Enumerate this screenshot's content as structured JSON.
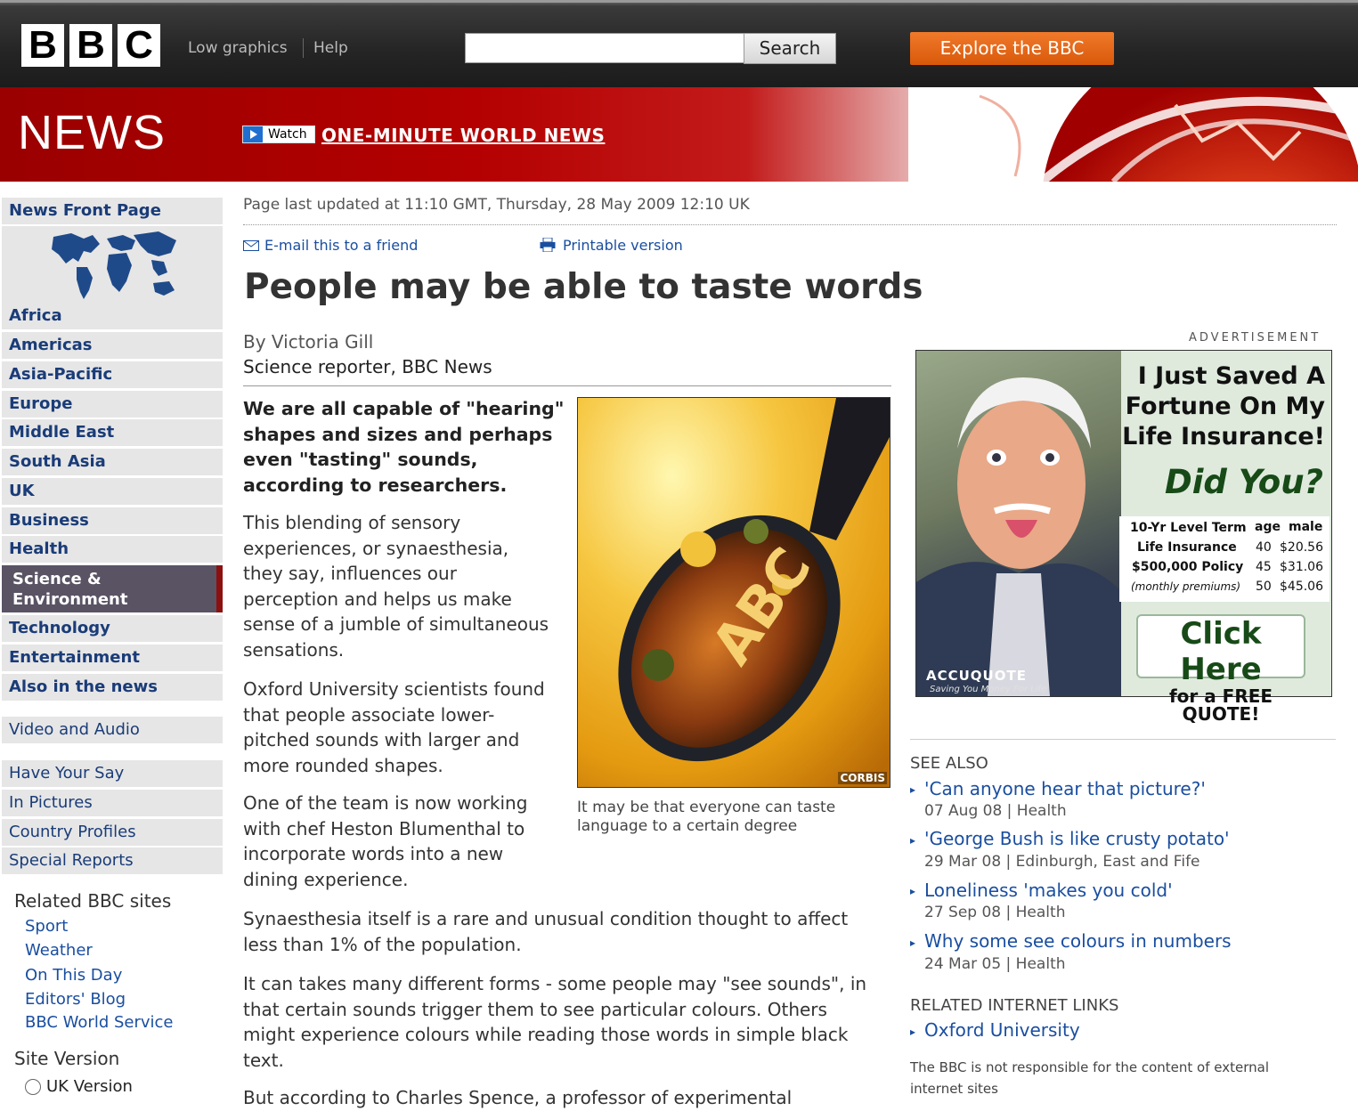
{
  "header": {
    "logo": [
      "B",
      "B",
      "C"
    ],
    "low_graphics": "Low graphics",
    "help": "Help",
    "search_button": "Search",
    "search_value": "",
    "explore": "Explore the BBC"
  },
  "banner": {
    "title": "NEWS",
    "watch_label": "Watch",
    "watch_link": "ONE-MINUTE WORLD NEWS"
  },
  "nav": {
    "front_page": "News Front Page",
    "items": [
      "Africa",
      "Americas",
      "Asia-Pacific",
      "Europe",
      "Middle East",
      "South Asia",
      "UK",
      "Business",
      "Health"
    ],
    "selected_line1": "Science &",
    "selected_line2": "Environment",
    "items2": [
      "Technology",
      "Entertainment",
      "Also in the news"
    ],
    "video_audio": "Video and Audio",
    "items3": [
      "Have Your Say",
      "In Pictures",
      "Country Profiles",
      "Special Reports"
    ],
    "related_heading": "Related BBC sites",
    "related": [
      "Sport",
      "Weather",
      "On This Day",
      "Editors' Blog",
      "BBC World Service"
    ],
    "site_version_heading": "Site Version",
    "uk_version": "UK Version"
  },
  "article": {
    "updated": "Page last updated at 11:10 GMT, Thursday, 28 May 2009 12:10 UK",
    "email": "E-mail this to a friend",
    "print": "Printable version",
    "headline": "People may be able to taste words",
    "author": "By Victoria Gill",
    "role": "Science reporter, BBC News",
    "intro": [
      "We are all capable of \"hearing\"",
      "shapes and sizes and perhaps",
      "even \"tasting\" sounds,",
      "according to researchers."
    ],
    "p1": [
      "This blending of sensory",
      "experiences, or synaesthesia,",
      "they say, influences our",
      "perception and helps us make",
      "sense of a jumble of simultaneous",
      "sensations."
    ],
    "p2": [
      "Oxford University scientists found",
      "that people associate lower-",
      "pitched sounds with larger and",
      "more rounded shapes."
    ],
    "p3": [
      "One of the team is now working",
      "with chef Heston Blumenthal to",
      "incorporate words into a new",
      "dining experience."
    ],
    "p4": [
      "Synaesthesia itself is a rare and unusual condition thought to affect",
      "less than 1% of the population."
    ],
    "p5": [
      "It can takes many different forms - some people may \"see sounds\", in",
      "that certain sounds trigger them to see particular colours. Others",
      "might experience colours while reading those words in simple black",
      "text."
    ],
    "p6": "But according to Charles Spence, a professor of experimental",
    "photo_credit": "CORBIS",
    "spoon_text": "ABC",
    "caption": [
      "It may be that everyone can taste",
      "language to a certain degree"
    ]
  },
  "ad": {
    "label": "ADVERTISEMENT",
    "headline": [
      "I Just Saved A",
      "Fortune On My",
      "Life Insurance!"
    ],
    "did_you": "Did You?",
    "table_left": [
      "10-Yr Level Term",
      "Life Insurance",
      "$500,000 Policy",
      "(monthly premiums)"
    ],
    "col_age": "age",
    "col_male": "male",
    "ages": [
      "40",
      "45",
      "50"
    ],
    "prices": [
      "$20.56",
      "$31.06",
      "$45.06"
    ],
    "click": "Click Here",
    "free": "for a FREE QUOTE!",
    "brand": "ACCUQUOTE",
    "tagline": "Saving You Money For Life"
  },
  "see_also": {
    "heading": "SEE ALSO",
    "links": [
      {
        "title": "'Can anyone hear that picture?'",
        "meta": "07 Aug 08 |  Health"
      },
      {
        "title": "'George Bush is like crusty potato'",
        "meta": "29 Mar 08 |  Edinburgh, East and Fife"
      },
      {
        "title": "Loneliness 'makes you cold'",
        "meta": "27 Sep 08 |  Health"
      },
      {
        "title": "Why some see colours in numbers",
        "meta": "24 Mar 05 |  Health"
      }
    ],
    "internet_heading": "RELATED INTERNET LINKS",
    "internet_link": "Oxford University",
    "disclaimer": [
      "The BBC is not responsible for the content of external",
      "internet sites"
    ]
  },
  "colors": {
    "news_red": "#b40000",
    "link_blue": "#1a4ea0",
    "nav_blue": "#1a3c78",
    "explore_orange": "#e8661a",
    "selected_nav": "#5a5364"
  }
}
